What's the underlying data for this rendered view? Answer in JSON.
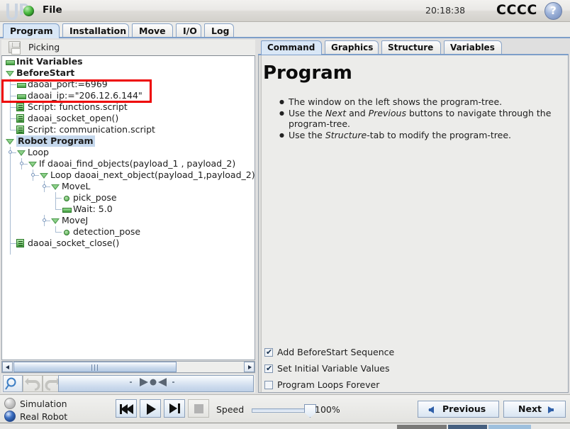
{
  "titlebar": {
    "logo": "UR",
    "file_menu": "File",
    "file_icon": "green-ball-icon",
    "clock": "20:18:38",
    "brand": "CCCC",
    "help_icon": "?"
  },
  "main_tabs": [
    {
      "label": "Program",
      "selected": true
    },
    {
      "label": "Installation",
      "selected": false
    },
    {
      "label": "Move",
      "selected": false
    },
    {
      "label": "I/O",
      "selected": false
    },
    {
      "label": "Log",
      "selected": false
    }
  ],
  "program": {
    "save_icon": "floppy-disk-icon",
    "name": "Picking"
  },
  "tree": [
    {
      "label": "Init Variables",
      "indent": 0,
      "glyph": "g-var",
      "bold": true,
      "selected": false,
      "lines": ""
    },
    {
      "label": "BeforeStart",
      "indent": 0,
      "glyph": "g-tri",
      "bold": true,
      "selected": false,
      "lines": ""
    },
    {
      "label": "daoai_port:=6969",
      "indent": 1,
      "glyph": "g-var",
      "bold": false,
      "selected": false,
      "lines": "mid"
    },
    {
      "label": "daoai_ip:=\"206.12.6.144\"",
      "indent": 1,
      "glyph": "g-var",
      "bold": false,
      "selected": false,
      "lines": "mid"
    },
    {
      "label": "Script: functions.script",
      "indent": 1,
      "glyph": "g-script",
      "bold": false,
      "selected": false,
      "lines": "mid"
    },
    {
      "label": "daoai_socket_open()",
      "indent": 1,
      "glyph": "g-script",
      "bold": false,
      "selected": false,
      "lines": "mid"
    },
    {
      "label": "Script: communication.script",
      "indent": 1,
      "glyph": "g-script",
      "bold": false,
      "selected": false,
      "lines": "end"
    },
    {
      "label": "Robot Program",
      "indent": 0,
      "glyph": "g-tri",
      "bold": true,
      "selected": true,
      "lines": ""
    },
    {
      "label": "Loop",
      "indent": 1,
      "glyph": "g-tri",
      "bold": false,
      "selected": false,
      "lines": "knob"
    },
    {
      "label": "If daoai_find_objects(payload_1 , payload_2)",
      "indent": 2,
      "glyph": "g-tri",
      "bold": false,
      "selected": false,
      "lines": "knob"
    },
    {
      "label": "Loop daoai_next_object(payload_1,payload_2)",
      "indent": 3,
      "glyph": "g-tri",
      "bold": false,
      "selected": false,
      "lines": "knob"
    },
    {
      "label": "MoveL",
      "indent": 4,
      "glyph": "g-tri",
      "bold": false,
      "selected": false,
      "lines": "knob"
    },
    {
      "label": "pick_pose",
      "indent": 5,
      "glyph": "g-dot",
      "bold": false,
      "selected": false,
      "lines": "mid"
    },
    {
      "label": "Wait: 5.0",
      "indent": 5,
      "glyph": "g-var",
      "bold": false,
      "selected": false,
      "lines": "end"
    },
    {
      "label": "MoveJ",
      "indent": 4,
      "glyph": "g-tri",
      "bold": false,
      "selected": false,
      "lines": "knob"
    },
    {
      "label": "detection_pose",
      "indent": 5,
      "glyph": "g-dot",
      "bold": false,
      "selected": false,
      "lines": "end"
    },
    {
      "label": "daoai_socket_close()",
      "indent": 1,
      "glyph": "g-script",
      "bold": false,
      "selected": false,
      "lines": "end"
    }
  ],
  "highlight": {
    "name": "red-annotation-box",
    "color": "#ee0000"
  },
  "tree_scrollbar": {
    "left_arrow_icon": "triangle-left-icon",
    "right_arrow_icon": "triangle-right-icon",
    "grip_icon": "scrollbar-grip-icon"
  },
  "left_toolbar": {
    "search_icon": "magnifier-icon",
    "undo_icon": "undo-arrow-icon",
    "redo_icon": "redo-arrow-icon",
    "move_bar_icon": "move-here-handle-icon"
  },
  "right_tabs": [
    {
      "label": "Command",
      "selected": true
    },
    {
      "label": "Graphics",
      "selected": false
    },
    {
      "label": "Structure",
      "selected": false
    },
    {
      "label": "Variables",
      "selected": false
    }
  ],
  "command_panel": {
    "title": "Program",
    "bullets": [
      {
        "pre": "The window on the left shows the program-tree.",
        "em1": "",
        "mid": "",
        "em2": "",
        "post": ""
      },
      {
        "pre": "Use the ",
        "em1": "Next",
        "mid": " and ",
        "em2": "Previous",
        "post": " buttons to navigate through the program-tree."
      },
      {
        "pre": "Use the ",
        "em1": "Structure",
        "mid": "-tab to modify the program-tree.",
        "em2": "",
        "post": ""
      }
    ],
    "checkboxes": [
      {
        "label": "Add BeforeStart Sequence",
        "checked": true
      },
      {
        "label": "Set Initial Variable Values",
        "checked": true
      },
      {
        "label": "Program Loops Forever",
        "checked": false
      }
    ]
  },
  "bottom": {
    "mode_options": [
      {
        "label": "Simulation",
        "selected": false
      },
      {
        "label": "Real Robot",
        "selected": true
      }
    ],
    "playback": [
      {
        "name": "rewind-button",
        "icon": "skip-back-icon"
      },
      {
        "name": "play-button",
        "icon": "play-icon"
      },
      {
        "name": "step-button",
        "icon": "skip-forward-icon"
      },
      {
        "name": "stop-button",
        "icon": "stop-square-icon"
      }
    ],
    "speed_label": "Speed",
    "speed_value": "100%",
    "previous_button": "Previous",
    "next_button": "Next"
  }
}
